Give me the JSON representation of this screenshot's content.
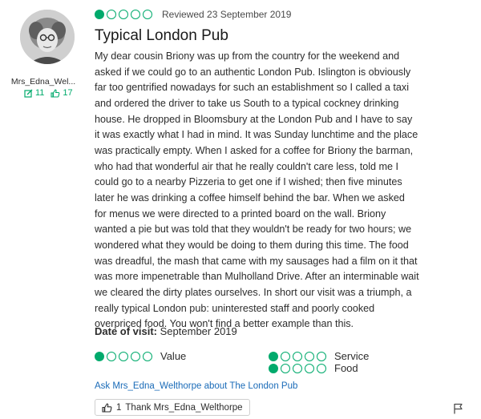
{
  "reviewer": {
    "name": "Mrs_Edna_Wel...",
    "reviews_count": "11",
    "helpful_votes": "17"
  },
  "review": {
    "rating": 1,
    "rating_max": 5,
    "reviewed_date": "Reviewed 23 September 2019",
    "title": "Typical London Pub",
    "body": "My dear cousin Briony was up from the country for the weekend and asked if we could go to an authentic London Pub. Islington is obviously far too gentrified nowadays for such an establishment so I called a taxi and ordered the driver to take us South to a typical cockney drinking house. He dropped in Bloomsbury at the London Pub and I have to say it was exactly what I had in mind. It was Sunday lunchtime and the place was practically empty. When I asked for a coffee for Briony the barman, who had that wonderful air that he really couldn't care less, told me I could go to a nearby Pizzeria to get one if I wished; then five minutes later he was drinking a coffee himself behind the bar. When we asked for menus we were directed to a printed board on the wall. Briony wanted a pie but was told that they wouldn't be ready for two hours; we wondered what they would be doing to them during this time. The food was dreadful, the mash that came with my sausages had a film on it that was more impenetrable than Mulholland Drive. After an interminable wait we cleared the dirty plates ourselves. In short our visit was a triumph, a really typical London pub: uninterested staff and poorly cooked overpriced food. You won't find a better example than this.",
    "date_of_visit_label": "Date of visit:",
    "date_of_visit_value": "September 2019",
    "subratings": [
      {
        "label": "Value",
        "rating": 1
      },
      {
        "label": "Service",
        "rating": 1
      },
      {
        "label": "Food",
        "rating": 1
      }
    ]
  },
  "actions": {
    "ask_link": "Ask Mrs_Edna_Welthorpe about The London Pub",
    "thank_count": "1",
    "thank_label": "Thank Mrs_Edna_Welthorpe"
  },
  "colors": {
    "rating_green": "#00aa6c",
    "link_blue": "#1a6bb8"
  },
  "icons": [
    "review-count-icon",
    "helpful-vote-icon",
    "thumbs-up-icon",
    "flag-icon"
  ]
}
